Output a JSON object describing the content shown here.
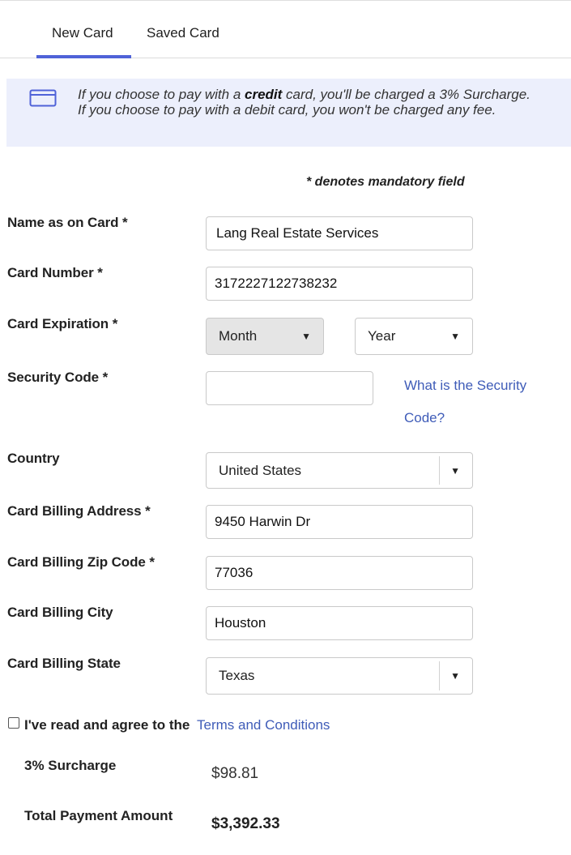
{
  "tabs": {
    "new_card": "New Card",
    "saved_card": "Saved Card"
  },
  "notice": {
    "prefix": "If you choose to pay with a ",
    "emphasis": "credit",
    "suffix": " card, you'll be charged a 3% Surcharge. If you choose to pay with a debit card, you won't be charged any fee."
  },
  "mandatory_note": "* denotes mandatory field",
  "form": {
    "name": {
      "label": "Name as on Card *",
      "value": "Lang Real Estate Services"
    },
    "card_number": {
      "label": "Card Number *",
      "value": "3172227122738232"
    },
    "expiration": {
      "label": "Card Expiration *",
      "month": "Month",
      "year": "Year"
    },
    "security": {
      "label": "Security Code *",
      "value": "",
      "help_link_1": "What is the Security",
      "help_link_2": "Code?"
    },
    "country": {
      "label": "Country",
      "value": "United States"
    },
    "address": {
      "label": "Card Billing Address *",
      "value": "9450 Harwin Dr"
    },
    "zip": {
      "label": "Card Billing Zip Code *",
      "value": "77036"
    },
    "city": {
      "label": "Card Billing City",
      "value": "Houston"
    },
    "state": {
      "label": "Card Billing State",
      "value": "Texas"
    }
  },
  "agreement": {
    "text": "I've read and agree to the",
    "link": "Terms and Conditions",
    "checked": false
  },
  "summary": {
    "surcharge_label": "3% Surcharge",
    "surcharge_value": "$98.81",
    "total_label": "Total Payment Amount",
    "total_value": "$3,392.33"
  },
  "icons": {
    "notice": "credit-card-icon",
    "dropdown": "caret-down-icon"
  },
  "colors": {
    "accent": "#4f62d8",
    "notice_bg": "#eceffc",
    "link": "#3f5cb8"
  }
}
